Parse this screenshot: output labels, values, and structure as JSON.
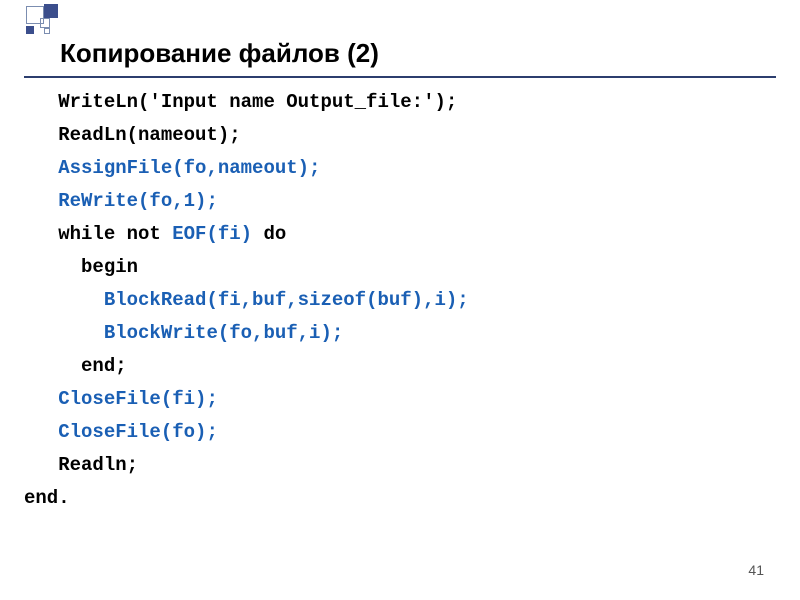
{
  "title": "Копирование файлов (2)",
  "page_number": "41",
  "code": {
    "l1": "   WriteLn('Input name Output_file:');",
    "l2": "   ReadLn(nameout);",
    "l3a": "   ",
    "l3b": "AssignFile(fo,nameout);",
    "l4a": "   ",
    "l4b": "ReWrite(fo,1);",
    "l5a": "   while not ",
    "l5b": "EOF(fi)",
    "l5c": " do",
    "l6": "     begin",
    "l7a": "       ",
    "l7b": "BlockRead(fi,buf,sizeof(buf),i);",
    "l8a": "       ",
    "l8b": "BlockWrite(fo,buf,i);",
    "l9": "     end;",
    "l10a": "   ",
    "l10b": "CloseFile(fi);",
    "l11a": "   ",
    "l11b": "CloseFile(fo);",
    "l12": "   Readln;",
    "l13": "end."
  }
}
